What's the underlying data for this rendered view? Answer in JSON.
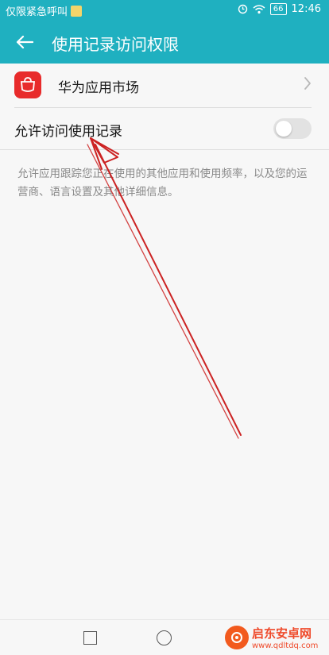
{
  "status_bar": {
    "carrier_text": "仅限紧急呼叫",
    "battery": "66",
    "time": "12:46"
  },
  "app_bar": {
    "title": "使用记录访问权限"
  },
  "app_row": {
    "name": "华为应用市场"
  },
  "toggle_row": {
    "label": "允许访问使用记录",
    "enabled": false
  },
  "description": "允许应用跟踪您正在使用的其他应用和使用频率，以及您的运营商、语言设置及其他详细信息。",
  "watermark": {
    "title": "启东安卓网",
    "url": "www.qdltdq.com"
  },
  "colors": {
    "accent": "#1fb0c0",
    "arrow": "#cc2222",
    "app_icon": "#e82b2b"
  },
  "icons": [
    "back-arrow-icon",
    "wifi-icon",
    "alarm-icon",
    "chevron-right-icon",
    "huawei-logo-icon"
  ]
}
